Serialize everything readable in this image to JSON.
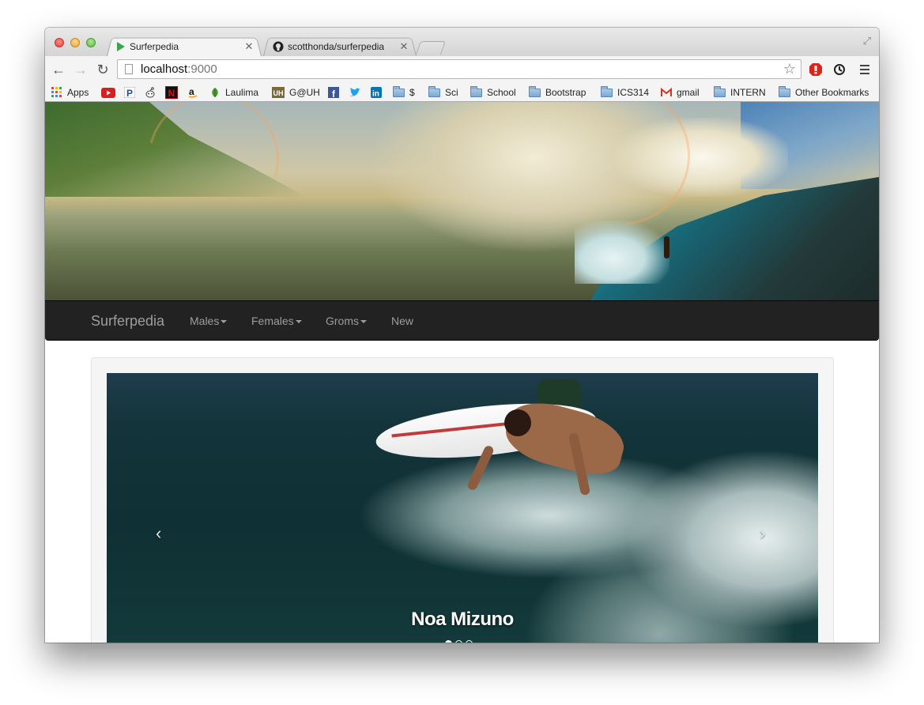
{
  "browser": {
    "tabs": [
      {
        "title": "Surferpedia",
        "active": true,
        "icon": "surferpedia-favicon"
      },
      {
        "title": "scotthonda/surferpedia",
        "active": false,
        "icon": "github-icon"
      }
    ],
    "url_host": "localhost",
    "url_port": ":9000",
    "bookmarks": [
      {
        "label": "Apps",
        "icon": "apps-grid-icon"
      },
      {
        "label": "",
        "icon": "youtube-icon"
      },
      {
        "label": "",
        "icon": "pandora-icon"
      },
      {
        "label": "",
        "icon": "reddit-icon"
      },
      {
        "label": "",
        "icon": "netflix-icon"
      },
      {
        "label": "",
        "icon": "amazon-icon"
      },
      {
        "label": "Laulima",
        "icon": "laulima-icon"
      },
      {
        "label": "G@UH",
        "icon": "uh-icon"
      },
      {
        "label": "",
        "icon": "facebook-icon"
      },
      {
        "label": "",
        "icon": "twitter-icon"
      },
      {
        "label": "",
        "icon": "linkedin-icon"
      },
      {
        "label": "$",
        "icon": "folder-icon"
      },
      {
        "label": "Sci",
        "icon": "folder-icon"
      },
      {
        "label": "School",
        "icon": "folder-icon"
      },
      {
        "label": "Bootstrap",
        "icon": "folder-icon"
      },
      {
        "label": "ICS314",
        "icon": "folder-icon"
      },
      {
        "label": "gmail",
        "icon": "gmail-icon"
      },
      {
        "label": "INTERN",
        "icon": "folder-icon"
      },
      {
        "label": "Other Bookmarks",
        "icon": "folder-icon"
      }
    ]
  },
  "navbar": {
    "brand": "Surferpedia",
    "items": [
      {
        "label": "Males",
        "dropdown": true
      },
      {
        "label": "Females",
        "dropdown": true
      },
      {
        "label": "Groms",
        "dropdown": true
      },
      {
        "label": "New",
        "dropdown": false
      }
    ]
  },
  "carousel": {
    "caption": "Noa Mizuno",
    "prev_icon": "‹",
    "next_icon": "›",
    "slide_count": 3,
    "active_index": 0
  },
  "colors": {
    "navbar_bg": "#222222",
    "navbar_text": "#9d9d9d",
    "well_bg": "#f5f5f5"
  }
}
